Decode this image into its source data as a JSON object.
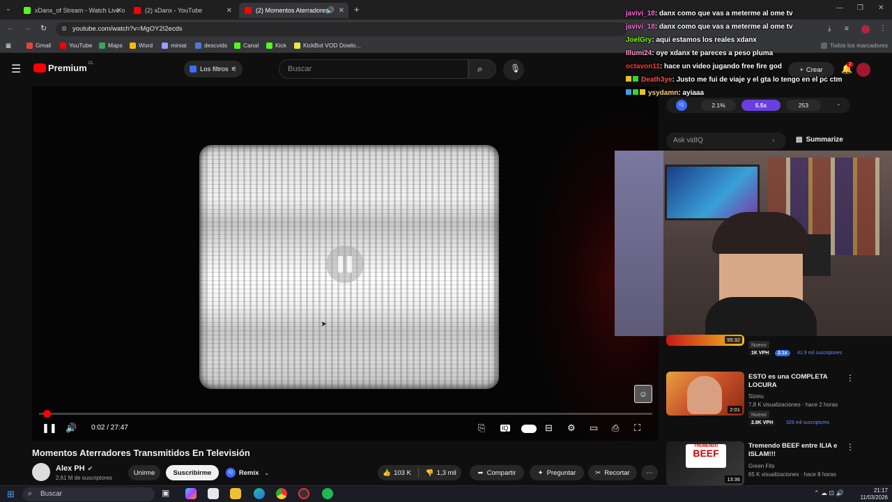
{
  "browser": {
    "tabs": [
      {
        "label": "xDanx_of Stream - Watch Live o",
        "favicon_color": "#53fc18"
      },
      {
        "label": "(2) xDanx - YouTube",
        "favicon_color": "#ff0000"
      },
      {
        "label": "(2) Momentos Aterradores",
        "favicon_color": "#ff0000"
      }
    ],
    "url": "youtube.com/watch?v=MgOY2I2ecds",
    "bookmarks": [
      "Gmail",
      "YouTube",
      "Maps",
      "Word",
      "miniat",
      "descvids",
      "Canal",
      "Kick",
      "KickBot VOD Dowlo..."
    ],
    "bookmarks_right": "Todos los marcadores"
  },
  "youtube": {
    "logo": "Premium",
    "logo_region": "CL",
    "filters_label": "Los filtros",
    "search_placeholder": "Buscar",
    "create_label": "Crear",
    "notif_count": "2"
  },
  "player": {
    "time": "0:02 / 27:47",
    "progress_fraction": 0.0012
  },
  "video": {
    "title": "Momentos Aterradores Transmitidos En Televisión",
    "channel": "Alex PH",
    "subscribers": "2,61 M de suscriptores",
    "join_label": "Unirme",
    "subscribe_label": "Suscribirme",
    "remix_label": "Remix",
    "likes": "103 K",
    "dislikes": "1,3 mil",
    "share_label": "Compartir",
    "ask_label": "Preguntar",
    "clip_label": "Recortar"
  },
  "sidebar": {
    "iq_stats": [
      "2.1%",
      "5.5x",
      "253"
    ],
    "ask_placeholder": "Ask vidIQ",
    "summarize_label": "Summarize",
    "recommendations": [
      {
        "duration": "55:32",
        "badge": "Nuevo",
        "vph": "1K VPH",
        "mult": "2.1x",
        "subs": "41.9 mil suscriptores"
      },
      {
        "title": "ESTO es una COMPLETA LOCURA",
        "channel": "Sizeiu",
        "meta": "7,8 K visualizaciones · hace 2 horas",
        "badge": "Nuevo",
        "duration": "2:01",
        "vph": "2.8K VPH",
        "subs": "329 mil suscriptores"
      },
      {
        "title": "Tremendo BEEF entre ILIA e ISLAM!!!",
        "channel": "Green Fits",
        "meta": "65 K visualizaciones · hace 8 horas",
        "duration": "13:36",
        "thumb_text": "BEEF",
        "thumb_top": "TREMENDO"
      }
    ]
  },
  "chat": [
    {
      "user": "javivi_18",
      "msg": ": danx como que vas a meterme al ome tv",
      "color": "#ff6ad5"
    },
    {
      "user": "javivi_18",
      "msg": ": danx como que vas a meterme al ome tv",
      "color": "#ff6ad5"
    },
    {
      "user": "JoelGry",
      "msg": ": aqui estamos los reales xdanx",
      "color": "#7cfc00"
    },
    {
      "user": "Illumi24",
      "msg": ": oye xdanx te pareces a peso pluma",
      "color": "#ff9ad0"
    },
    {
      "user": "octavon11",
      "msg": ": hace un video jugando free fire god",
      "color": "#ff3b3b"
    },
    {
      "user": "Death3ye",
      "msg": ": Justo me fui de viaje y el gta lo tengo en el pc ctm",
      "color": "#ff4d4d"
    },
    {
      "user": "ysydamn",
      "msg": ": ayiaaa",
      "color": "#f7d774"
    }
  ],
  "taskbar": {
    "search_placeholder": "Buscar",
    "time": "21:17",
    "date": "11/03/2026"
  }
}
